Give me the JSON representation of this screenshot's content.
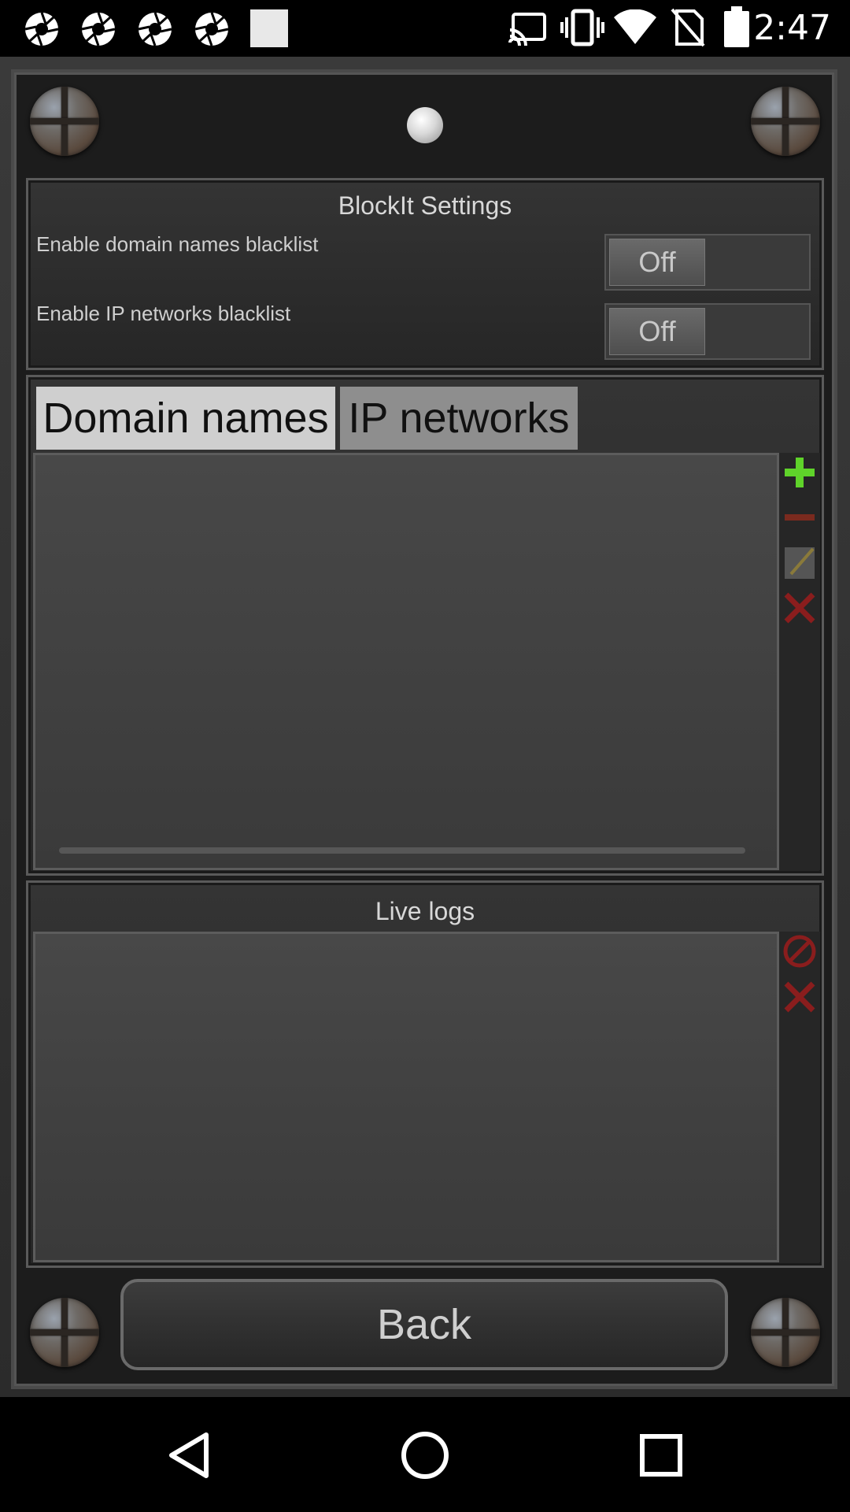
{
  "status_bar": {
    "time": "2:47",
    "icons": [
      "shutter-icon",
      "shutter-icon",
      "shutter-icon",
      "shutter-icon",
      "square-notification-icon",
      "cast-icon",
      "vibrate-icon",
      "wifi-icon",
      "no-sim-icon",
      "battery-icon"
    ]
  },
  "settings": {
    "title": "BlockIt Settings",
    "domain_label": "Enable domain names blacklist",
    "domain_toggle": "Off",
    "ip_label": "Enable IP networks blacklist",
    "ip_toggle": "Off"
  },
  "tabs": {
    "domain": "Domain names",
    "ip": "IP networks",
    "active": "domain"
  },
  "list_actions": [
    "add-icon",
    "remove-icon",
    "edit-icon",
    "delete-icon"
  ],
  "logs": {
    "title": "Live logs",
    "actions": [
      "block-icon",
      "clear-icon"
    ]
  },
  "back_label": "Back",
  "colors": {
    "add": "#5fd32a",
    "remove": "#7a2a1e",
    "delete": "#8a1d1d",
    "active_tab": "#cfcfcf",
    "inactive_tab": "#8e8e8e"
  }
}
